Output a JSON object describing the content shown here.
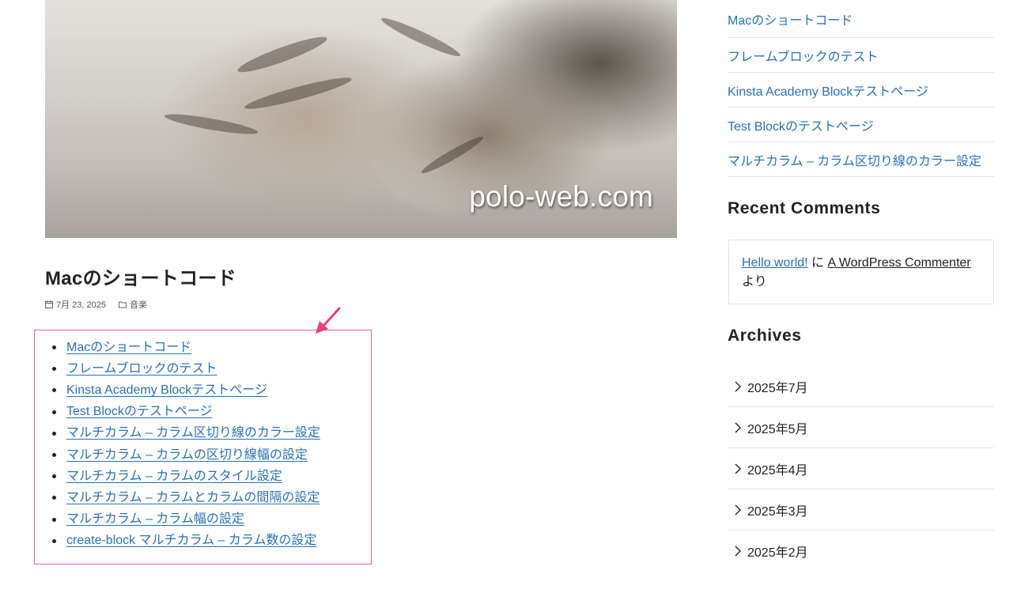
{
  "hero": {
    "watermark": "polo-web.com"
  },
  "post": {
    "title": "Macのショートコード",
    "date": "7月 23, 2025",
    "category": "音楽",
    "links": [
      "Macのショートコード",
      "フレームブロックのテスト",
      "Kinsta Academy Blockテストページ",
      "Test Blockのテストページ",
      "マルチカラム – カラム区切り線のカラー設定",
      "マルチカラム – カラムの区切り線幅の設定",
      "マルチカラム – カラムのスタイル設定",
      "マルチカラム – カラムとカラムの間隔の設定",
      "マルチカラム – カラム幅の設定",
      "create-block マルチカラム – カラム数の設定"
    ]
  },
  "sidebar": {
    "recent_posts": [
      "Macのショートコード",
      "フレームブロックのテスト",
      "Kinsta Academy Blockテストページ",
      "Test Blockのテストページ",
      "マルチカラム – カラム区切り線のカラー設定"
    ],
    "recent_comments": {
      "title": "Recent Comments",
      "post_link": "Hello world!",
      "connector": "に",
      "author_link": "A WordPress Commenter",
      "suffix": "より"
    },
    "archives": {
      "title": "Archives",
      "items": [
        "2025年7月",
        "2025年5月",
        "2025年4月",
        "2025年3月",
        "2025年2月"
      ]
    }
  },
  "colors": {
    "link": "#2872b6",
    "highlight_border": "#ea5f9a",
    "arrow": "#ea3f7f"
  }
}
